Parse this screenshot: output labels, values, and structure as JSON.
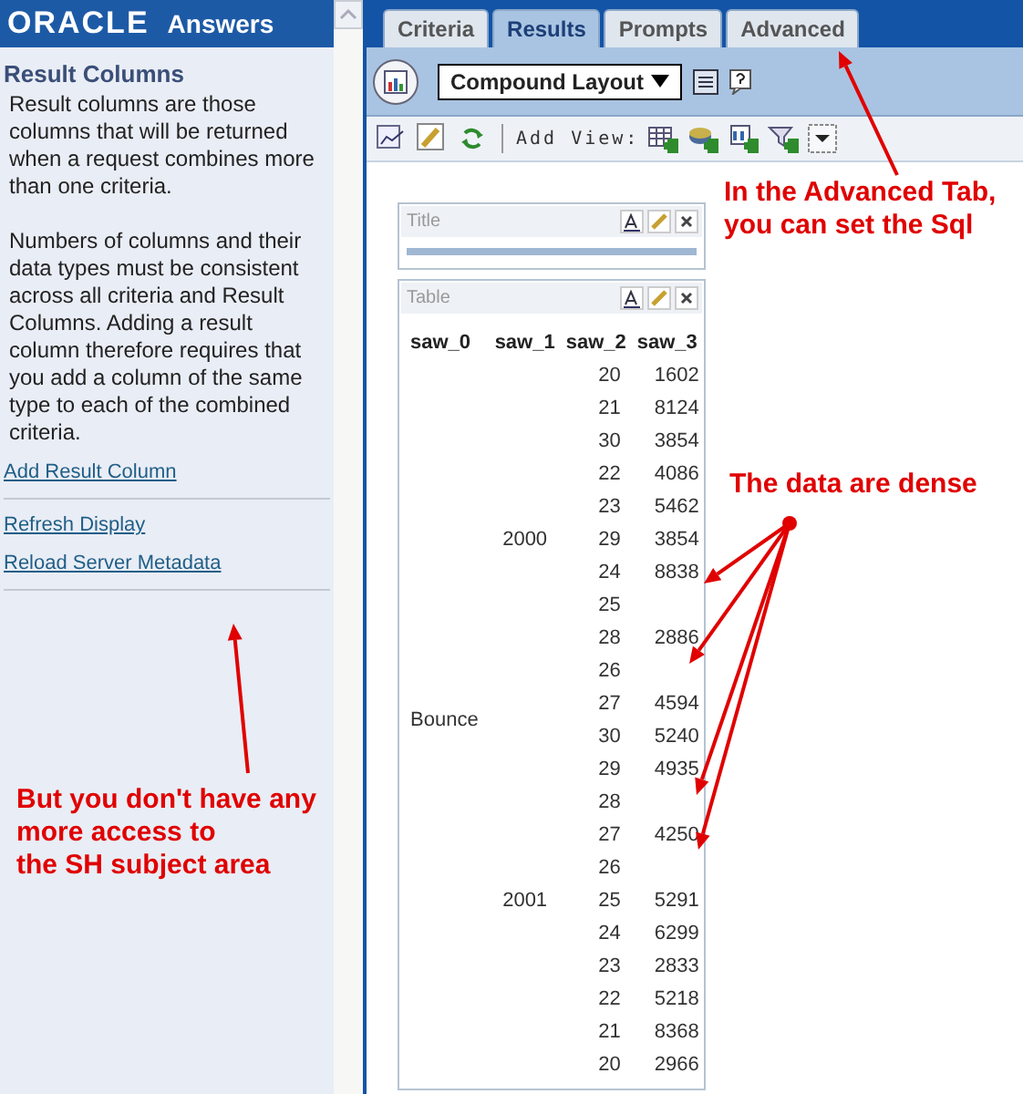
{
  "header": {
    "brand": "ORACLE",
    "product": "Answers"
  },
  "sidebar": {
    "title": "Result Columns",
    "paragraphs": [
      "Result columns are those columns that will be returned when a request combines more than one criteria.",
      "Numbers of columns and their data types must be consistent across all criteria and Result Columns. Adding a result column therefore requires that you add a column of the same type to each of the combined criteria."
    ],
    "links": [
      "Add Result Column",
      "Refresh Display",
      "Reload Server Metadata"
    ]
  },
  "tabs": [
    {
      "label": "Criteria",
      "selected": false
    },
    {
      "label": "Results",
      "selected": true
    },
    {
      "label": "Prompts",
      "selected": false
    },
    {
      "label": "Advanced",
      "selected": false
    }
  ],
  "layout_select": {
    "value": "Compound Layout"
  },
  "toolbar": {
    "add_view_label": "Add View:"
  },
  "views": [
    {
      "kind": "title",
      "label": "Title"
    },
    {
      "kind": "table",
      "label": "Table"
    }
  ],
  "table": {
    "columns": [
      "saw_0",
      "saw_1",
      "saw_2",
      "saw_3"
    ],
    "groups": [
      {
        "saw_0": "Bounce",
        "children": [
          {
            "saw_1": "2000",
            "rows": [
              {
                "saw_2": "20",
                "saw_3": "1602"
              },
              {
                "saw_2": "21",
                "saw_3": "8124"
              },
              {
                "saw_2": "30",
                "saw_3": "3854"
              },
              {
                "saw_2": "22",
                "saw_3": "4086"
              },
              {
                "saw_2": "23",
                "saw_3": "5462"
              },
              {
                "saw_2": "29",
                "saw_3": "3854"
              },
              {
                "saw_2": "24",
                "saw_3": "8838"
              },
              {
                "saw_2": "25"
              },
              {
                "saw_2": "28",
                "saw_3": "2886"
              },
              {
                "saw_2": "26"
              },
              {
                "saw_2": "27",
                "saw_3": "4594"
              }
            ]
          },
          {
            "saw_1": "2001",
            "rows": [
              {
                "saw_2": "30",
                "saw_3": "5240"
              },
              {
                "saw_2": "29",
                "saw_3": "4935"
              },
              {
                "saw_2": "28"
              },
              {
                "saw_2": "27",
                "saw_3": "4250"
              },
              {
                "saw_2": "26"
              },
              {
                "saw_2": "25",
                "saw_3": "5291"
              },
              {
                "saw_2": "24",
                "saw_3": "6299"
              },
              {
                "saw_2": "23",
                "saw_3": "2833"
              },
              {
                "saw_2": "22",
                "saw_3": "5218"
              },
              {
                "saw_2": "21",
                "saw_3": "8368"
              },
              {
                "saw_2": "20",
                "saw_3": "2966"
              }
            ]
          }
        ]
      }
    ]
  },
  "annotations": [
    {
      "lines": [
        "In the Advanced Tab,",
        "you can set the Sql"
      ]
    },
    {
      "lines": [
        "The data are dense"
      ]
    },
    {
      "lines": [
        "But you don't have any",
        "more access to",
        "the SH subject area"
      ]
    }
  ]
}
